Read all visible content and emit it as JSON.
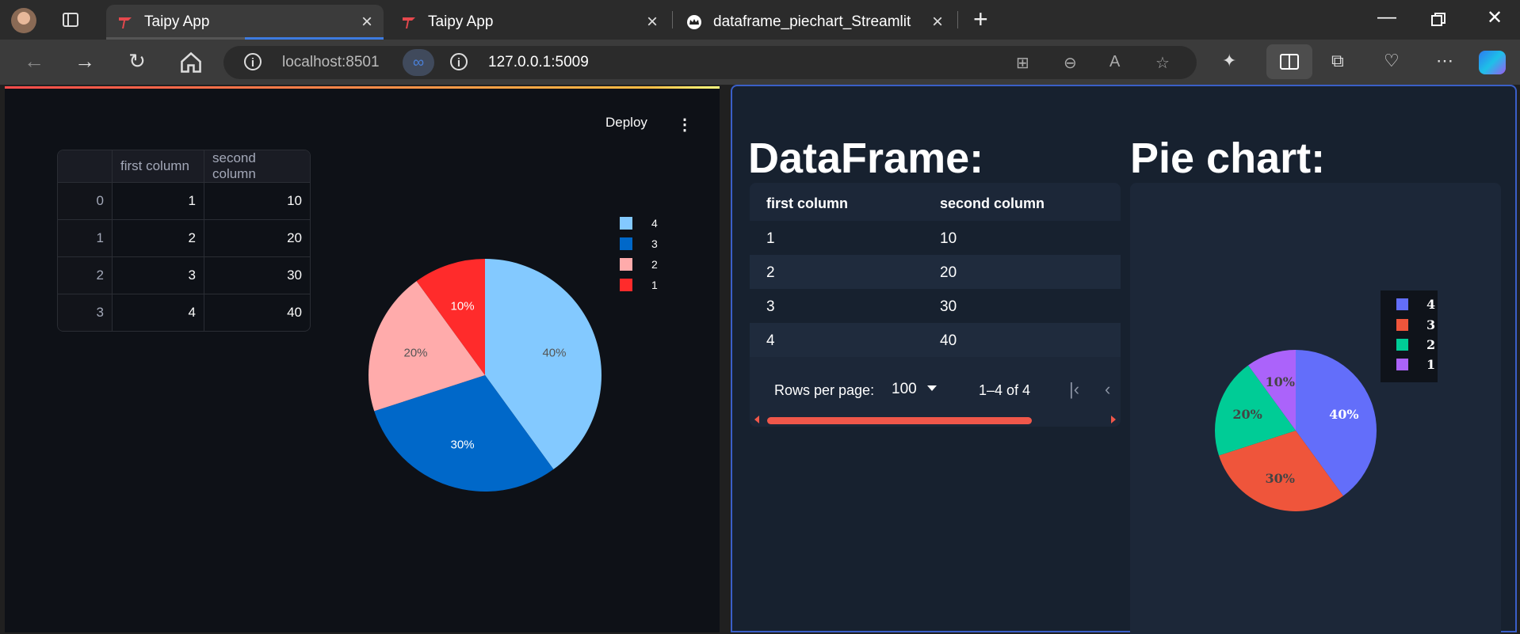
{
  "browser": {
    "tabs": [
      {
        "title": "Taipy App",
        "active": true
      },
      {
        "title": "Taipy App",
        "active": false
      },
      {
        "title": "dataframe_piechart_Streamlit",
        "active": false
      }
    ],
    "address_left": "localhost:8501",
    "address_right": "127.0.0.1:5009"
  },
  "streamlit": {
    "deploy_label": "Deploy",
    "menu_glyph": "⋮",
    "table": {
      "columns": [
        "",
        "first column",
        "second column"
      ],
      "rows": [
        [
          "0",
          "1",
          "10"
        ],
        [
          "1",
          "2",
          "20"
        ],
        [
          "2",
          "3",
          "30"
        ],
        [
          "3",
          "4",
          "40"
        ]
      ]
    }
  },
  "taipy": {
    "dataframe_heading": "DataFrame:",
    "pie_heading": "Pie chart:",
    "table": {
      "columns": [
        "first column",
        "second column"
      ],
      "rows": [
        [
          "1",
          "10"
        ],
        [
          "2",
          "20"
        ],
        [
          "3",
          "30"
        ],
        [
          "4",
          "40"
        ]
      ]
    },
    "pager": {
      "rows_per_page_label": "Rows per page:",
      "rows_per_page_value": "100",
      "range_text": "1–4 of 4"
    }
  },
  "chart_data": [
    {
      "type": "pie",
      "labels": [
        "4",
        "3",
        "2",
        "1"
      ],
      "values": [
        40,
        30,
        20,
        10
      ],
      "percent_labels": [
        "40%",
        "30%",
        "20%",
        "10%"
      ],
      "colors": [
        "#83c9ff",
        "#0068c9",
        "#ffabab",
        "#ff2b2b"
      ],
      "legend": "top-right"
    },
    {
      "type": "pie",
      "labels": [
        "4",
        "3",
        "2",
        "1"
      ],
      "values": [
        40,
        30,
        20,
        10
      ],
      "percent_labels": [
        "40%",
        "30%",
        "20%",
        "10%"
      ],
      "colors": [
        "#636efa",
        "#ef553b",
        "#00cc96",
        "#ab63fa"
      ],
      "legend": "top-right"
    }
  ]
}
